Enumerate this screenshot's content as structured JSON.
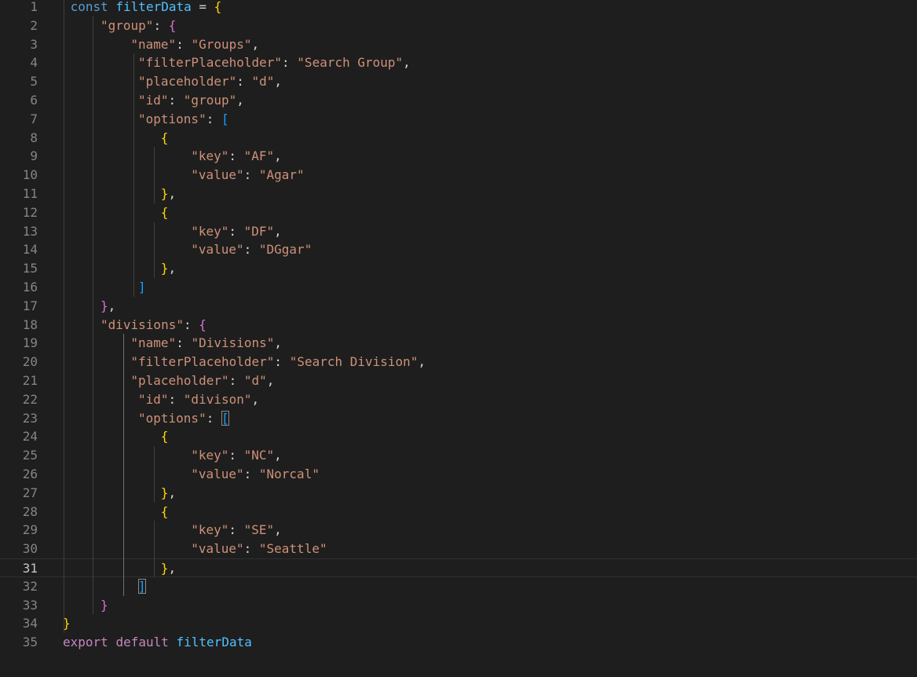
{
  "editor": {
    "language": "javascript",
    "current_line": 31,
    "colors": {
      "background": "#1e1e1e",
      "line_number": "#858585",
      "keyword": "#569cd6",
      "keyword_control": "#c586c0",
      "variable": "#4fc1ff",
      "string": "#ce9178",
      "punctuation": "#d4d4d4",
      "bracket_level_1": "#ffd700",
      "bracket_level_2": "#da70d6",
      "bracket_level_3": "#179fff"
    },
    "lines": [
      {
        "n": "1",
        "indent": 1,
        "tokens": [
          [
            "kw",
            "const"
          ],
          [
            "punc",
            " "
          ],
          [
            "var",
            "filterData"
          ],
          [
            "punc",
            " = "
          ],
          [
            "b1",
            "{"
          ]
        ]
      },
      {
        "n": "2",
        "indent": 5,
        "tokens": [
          [
            "str",
            "\"group\""
          ],
          [
            "punc",
            ": "
          ],
          [
            "b2",
            "{"
          ]
        ]
      },
      {
        "n": "3",
        "indent": 9,
        "tokens": [
          [
            "str",
            "\"name\""
          ],
          [
            "punc",
            ": "
          ],
          [
            "str",
            "\"Groups\""
          ],
          [
            "punc",
            ","
          ]
        ]
      },
      {
        "n": "4",
        "indent": 10,
        "tokens": [
          [
            "str",
            "\"filterPlaceholder\""
          ],
          [
            "punc",
            ": "
          ],
          [
            "str",
            "\"Search Group\""
          ],
          [
            "punc",
            ","
          ]
        ]
      },
      {
        "n": "5",
        "indent": 10,
        "tokens": [
          [
            "str",
            "\"placeholder\""
          ],
          [
            "punc",
            ": "
          ],
          [
            "str",
            "\"d\""
          ],
          [
            "punc",
            ","
          ]
        ]
      },
      {
        "n": "6",
        "indent": 10,
        "tokens": [
          [
            "str",
            "\"id\""
          ],
          [
            "punc",
            ": "
          ],
          [
            "str",
            "\"group\""
          ],
          [
            "punc",
            ","
          ]
        ]
      },
      {
        "n": "7",
        "indent": 10,
        "tokens": [
          [
            "str",
            "\"options\""
          ],
          [
            "punc",
            ": "
          ],
          [
            "b3",
            "["
          ]
        ]
      },
      {
        "n": "8",
        "indent": 13,
        "tokens": [
          [
            "b1",
            "{"
          ]
        ]
      },
      {
        "n": "9",
        "indent": 17,
        "tokens": [
          [
            "str",
            "\"key\""
          ],
          [
            "punc",
            ": "
          ],
          [
            "str",
            "\"AF\""
          ],
          [
            "punc",
            ","
          ]
        ]
      },
      {
        "n": "10",
        "indent": 17,
        "tokens": [
          [
            "str",
            "\"value\""
          ],
          [
            "punc",
            ": "
          ],
          [
            "str",
            "\"Agar\""
          ]
        ]
      },
      {
        "n": "11",
        "indent": 13,
        "tokens": [
          [
            "b1",
            "}"
          ],
          [
            "punc",
            ","
          ]
        ]
      },
      {
        "n": "12",
        "indent": 13,
        "tokens": [
          [
            "b1",
            "{"
          ]
        ]
      },
      {
        "n": "13",
        "indent": 17,
        "tokens": [
          [
            "str",
            "\"key\""
          ],
          [
            "punc",
            ": "
          ],
          [
            "str",
            "\"DF\""
          ],
          [
            "punc",
            ","
          ]
        ]
      },
      {
        "n": "14",
        "indent": 17,
        "tokens": [
          [
            "str",
            "\"value\""
          ],
          [
            "punc",
            ": "
          ],
          [
            "str",
            "\"DGgar\""
          ]
        ]
      },
      {
        "n": "15",
        "indent": 13,
        "tokens": [
          [
            "b1",
            "}"
          ],
          [
            "punc",
            ","
          ]
        ]
      },
      {
        "n": "16",
        "indent": 10,
        "tokens": [
          [
            "b3",
            "]"
          ]
        ]
      },
      {
        "n": "17",
        "indent": 5,
        "tokens": [
          [
            "b2",
            "}"
          ],
          [
            "punc",
            ","
          ]
        ]
      },
      {
        "n": "18",
        "indent": 5,
        "tokens": [
          [
            "str",
            "\"divisions\""
          ],
          [
            "punc",
            ": "
          ],
          [
            "b2",
            "{"
          ]
        ]
      },
      {
        "n": "19",
        "indent": 9,
        "tokens": [
          [
            "str",
            "\"name\""
          ],
          [
            "punc",
            ": "
          ],
          [
            "str",
            "\"Divisions\""
          ],
          [
            "punc",
            ","
          ]
        ]
      },
      {
        "n": "20",
        "indent": 9,
        "tokens": [
          [
            "str",
            "\"filterPlaceholder\""
          ],
          [
            "punc",
            ": "
          ],
          [
            "str",
            "\"Search Division\""
          ],
          [
            "punc",
            ","
          ]
        ]
      },
      {
        "n": "21",
        "indent": 9,
        "tokens": [
          [
            "str",
            "\"placeholder\""
          ],
          [
            "punc",
            ": "
          ],
          [
            "str",
            "\"d\""
          ],
          [
            "punc",
            ","
          ]
        ]
      },
      {
        "n": "22",
        "indent": 10,
        "tokens": [
          [
            "str",
            "\"id\""
          ],
          [
            "punc",
            ": "
          ],
          [
            "str",
            "\"divison\""
          ],
          [
            "punc",
            ","
          ]
        ]
      },
      {
        "n": "23",
        "indent": 10,
        "tokens": [
          [
            "str",
            "\"options\""
          ],
          [
            "punc",
            ": "
          ],
          [
            "b3m",
            "["
          ]
        ]
      },
      {
        "n": "24",
        "indent": 13,
        "tokens": [
          [
            "b1",
            "{"
          ]
        ]
      },
      {
        "n": "25",
        "indent": 17,
        "tokens": [
          [
            "str",
            "\"key\""
          ],
          [
            "punc",
            ": "
          ],
          [
            "str",
            "\"NC\""
          ],
          [
            "punc",
            ","
          ]
        ]
      },
      {
        "n": "26",
        "indent": 17,
        "tokens": [
          [
            "str",
            "\"value\""
          ],
          [
            "punc",
            ": "
          ],
          [
            "str",
            "\"Norcal\""
          ]
        ]
      },
      {
        "n": "27",
        "indent": 13,
        "tokens": [
          [
            "b1",
            "}"
          ],
          [
            "punc",
            ","
          ]
        ]
      },
      {
        "n": "28",
        "indent": 13,
        "tokens": [
          [
            "b1",
            "{"
          ]
        ]
      },
      {
        "n": "29",
        "indent": 17,
        "tokens": [
          [
            "str",
            "\"key\""
          ],
          [
            "punc",
            ": "
          ],
          [
            "str",
            "\"SE\""
          ],
          [
            "punc",
            ","
          ]
        ]
      },
      {
        "n": "30",
        "indent": 17,
        "tokens": [
          [
            "str",
            "\"value\""
          ],
          [
            "punc",
            ": "
          ],
          [
            "str",
            "\"Seattle\""
          ]
        ]
      },
      {
        "n": "31",
        "indent": 13,
        "tokens": [
          [
            "b1",
            "}"
          ],
          [
            "punc",
            ","
          ]
        ]
      },
      {
        "n": "32",
        "indent": 10,
        "tokens": [
          [
            "b3m",
            "]"
          ]
        ]
      },
      {
        "n": "33",
        "indent": 5,
        "tokens": [
          [
            "b2",
            "}"
          ]
        ]
      },
      {
        "n": "34",
        "indent": 0,
        "tokens": [
          [
            "b1",
            "}"
          ]
        ]
      },
      {
        "n": "35",
        "indent": 0,
        "tokens": [
          [
            "kw2",
            "export"
          ],
          [
            "punc",
            " "
          ],
          [
            "kw2",
            "default"
          ],
          [
            "punc",
            " "
          ],
          [
            "var",
            "filterData"
          ]
        ]
      }
    ]
  }
}
